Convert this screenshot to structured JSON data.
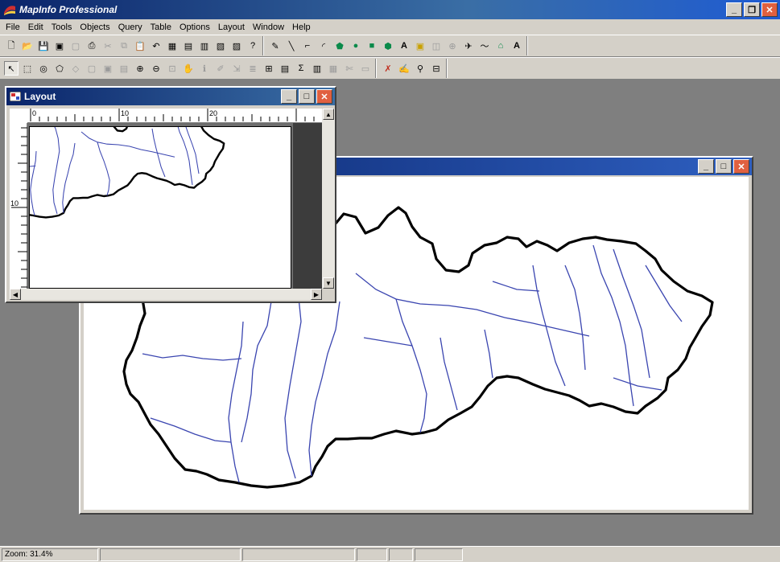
{
  "app": {
    "title": "MapInfo Professional"
  },
  "menu": [
    "File",
    "Edit",
    "Tools",
    "Objects",
    "Query",
    "Table",
    "Options",
    "Layout",
    "Window",
    "Help"
  ],
  "toolbars": {
    "standard": [
      "new-icon",
      "open-icon",
      "save-icon",
      "save-as-icon",
      "print-icon",
      "cut-icon",
      "copy-icon",
      "paste-icon",
      "undo-icon",
      "new-browser-icon",
      "new-mapper-icon",
      "new-grapher-icon",
      "new-layout-icon",
      "help-icon"
    ],
    "drawing": [
      "symbol-icon",
      "line-icon",
      "polyline-icon",
      "arc-icon",
      "polygon-icon",
      "ellipse-icon",
      "rectangle-icon",
      "rounded-rect-icon",
      "text-icon",
      "frame-icon",
      "reshape-icon",
      "add-node-icon",
      "symbol-style-icon",
      "line-style-icon",
      "region-style-icon",
      "text-style-icon"
    ],
    "main": [
      "select-icon",
      "marquee-icon",
      "radius-icon",
      "polygon-select-icon",
      "boundary-icon",
      "unselect-icon",
      "invert-icon",
      "graph-select-icon",
      "zoom-in-icon",
      "zoom-out-icon",
      "change-view-icon",
      "grabber-icon",
      "info-icon",
      "label-icon",
      "drag-window-icon",
      "layer-control-icon",
      "ruler-icon",
      "legend-icon",
      "statistics-icon",
      "sum-icon",
      "thematic-icon",
      "hotlink-icon",
      "clip-region-icon",
      "scale-bar-icon",
      "run-icon",
      "script-icon",
      "map-icon",
      "save-workspace-icon"
    ]
  },
  "windows": {
    "layout": {
      "title": "Layout",
      "ruler_labels": [
        "0",
        "10",
        "20"
      ],
      "vruler_label": "10"
    },
    "map": {
      "title": ""
    }
  },
  "statusbar": {
    "zoom": "Zoom: 31.4%"
  },
  "colors": {
    "titlebar": "#0a246a",
    "river": "#3a45b0",
    "border": "#000000"
  }
}
